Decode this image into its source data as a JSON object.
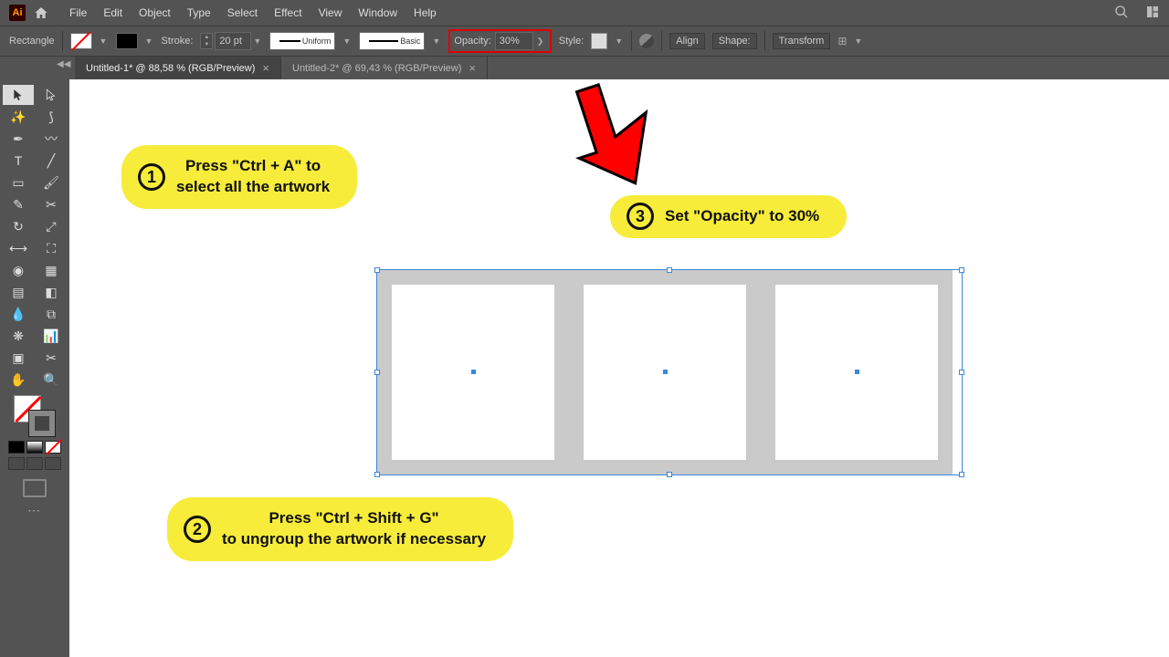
{
  "menu": {
    "file": "File",
    "edit": "Edit",
    "object": "Object",
    "type": "Type",
    "select": "Select",
    "effect": "Effect",
    "view": "View",
    "window": "Window",
    "help": "Help"
  },
  "control": {
    "shape_name": "Rectangle",
    "stroke_label": "Stroke:",
    "stroke_value": "20 pt",
    "profile_uniform": "Uniform",
    "profile_basic": "Basic",
    "opacity_label": "Opacity:",
    "opacity_value": "30%",
    "style_label": "Style:",
    "align_label": "Align",
    "shape_label": "Shape:",
    "transform_label": "Transform"
  },
  "tabs": {
    "tab1": "Untitled-1* @ 88,58 % (RGB/Preview)",
    "tab2": "Untitled-2* @ 69,43 % (RGB/Preview)"
  },
  "callouts": {
    "c1_line1": "Press \"Ctrl + A\" to",
    "c1_line2": "select all the artwork",
    "c2_line1": "Press \"Ctrl + Shift + G\"",
    "c2_line2": "to ungroup the artwork if necessary",
    "c3": "Set \"Opacity\" to 30%"
  }
}
